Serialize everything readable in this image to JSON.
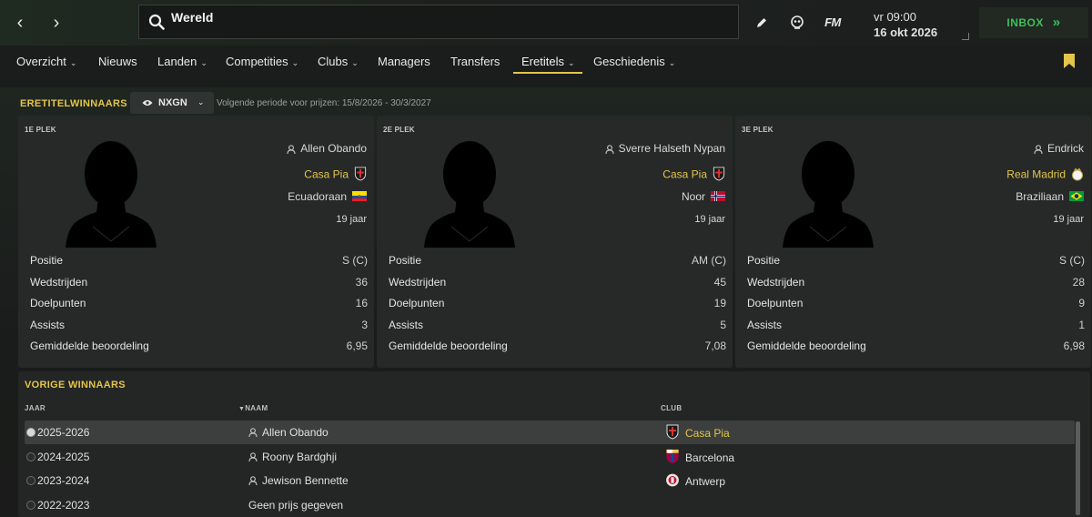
{
  "header": {
    "search_value": "Wereld",
    "time": "vr 09:00",
    "date": "16 okt 2026",
    "brand": "FM",
    "inbox_label": "INBOX",
    "inbox_arrows": "»"
  },
  "menu": [
    {
      "label": "Overzicht",
      "dropdown": true
    },
    {
      "label": "Nieuws",
      "dropdown": false
    },
    {
      "label": "Landen",
      "dropdown": true
    },
    {
      "label": "Competities",
      "dropdown": true
    },
    {
      "label": "Clubs",
      "dropdown": true
    },
    {
      "label": "Managers",
      "dropdown": false
    },
    {
      "label": "Transfers",
      "dropdown": false
    },
    {
      "label": "Eretitels",
      "dropdown": true,
      "active": true
    },
    {
      "label": "Geschiedenis",
      "dropdown": true
    }
  ],
  "awards": {
    "title": "ERETITELWINNAARS",
    "filter_label": "NXGN",
    "period_text": "Volgende periode voor prijzen: 15/8/2026 - 30/3/2027",
    "stat_labels": {
      "positie": "Positie",
      "wedstrijden": "Wedstrijden",
      "doelpunten": "Doelpunten",
      "assists": "Assists",
      "beoordeling": "Gemiddelde beoordeling"
    },
    "cards": [
      {
        "place": "1E PLEK",
        "name": "Allen Obando",
        "club": "Casa Pia",
        "club_icon": "casa-pia-crest",
        "nationality": "Ecuadoraan",
        "flag": "ecuador-flag",
        "age": "19 jaar",
        "positie": "S (C)",
        "wedstrijden": "36",
        "doelpunten": "16",
        "assists": "3",
        "beoordeling": "6,95"
      },
      {
        "place": "2E PLEK",
        "name": "Sverre Halseth Nypan",
        "club": "Casa Pia",
        "club_icon": "casa-pia-crest",
        "nationality": "Noor",
        "flag": "norway-flag",
        "age": "19 jaar",
        "positie": "AM (C)",
        "wedstrijden": "45",
        "doelpunten": "19",
        "assists": "5",
        "beoordeling": "7,08"
      },
      {
        "place": "3E PLEK",
        "name": "Endrick",
        "club": "Real Madrid",
        "club_icon": "real-madrid-crest",
        "nationality": "Braziliaan",
        "flag": "brazil-flag",
        "age": "19 jaar",
        "positie": "S (C)",
        "wedstrijden": "28",
        "doelpunten": "9",
        "assists": "1",
        "beoordeling": "6,98"
      }
    ]
  },
  "previous": {
    "title": "VORIGE WINNAARS",
    "columns": {
      "year": "JAAR",
      "name": "NAAM",
      "club": "CLUB"
    },
    "rows": [
      {
        "year": "2025-2026",
        "name": "Allen Obando",
        "club": "Casa Pia",
        "club_icon": "casa-pia-crest",
        "selected": true
      },
      {
        "year": "2024-2025",
        "name": "Roony Bardghji",
        "club": "Barcelona",
        "club_icon": "barcelona-crest"
      },
      {
        "year": "2023-2024",
        "name": "Jewison Bennette",
        "club": "Antwerp",
        "club_icon": "antwerp-crest"
      },
      {
        "year": "2022-2023",
        "name": "Geen prijs gegeven",
        "club": ""
      }
    ]
  },
  "colors": {
    "accent": "#e3c54a",
    "inbox": "#3dbf5b",
    "card_bg": "#262928"
  }
}
